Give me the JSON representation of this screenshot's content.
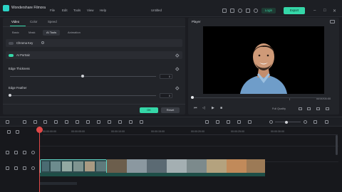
{
  "titlebar": {
    "app_name": "Wondershare Filmora",
    "menus": [
      "File",
      "Edit",
      "Tools",
      "View",
      "Help"
    ],
    "document_title": "Untitled",
    "login_label": "Login",
    "export_label": "Export"
  },
  "properties": {
    "tabs": [
      "Video",
      "Color",
      "Speed"
    ],
    "subtabs": [
      "Basic",
      "Mask",
      "AI Tools",
      "Animation"
    ],
    "chroma_key_label": "Chroma Key",
    "ai_portrait_label": "AI Portrait",
    "edge_thickness_label": "Edge Thickness",
    "edge_thickness_value": "0",
    "edge_feather_label": "Edge Feather",
    "edge_feather_value": "0",
    "ok_label": "OK",
    "reset_label": "Reset"
  },
  "player": {
    "label": "Player",
    "time_left": "[",
    "time_current": "00:00:00:00",
    "quality_label": "Full Quality",
    "time_right": "00:00:08:19"
  },
  "timeline": {
    "ticks": [
      "00:00:00:00",
      "00:00:05:00",
      "00:00:10:00",
      "00:00:15:00",
      "00:00:20:00",
      "00:00:25:00",
      "00:00:30:00"
    ]
  },
  "colors": {
    "accent": "#35d7a8",
    "playhead": "#e04848"
  }
}
